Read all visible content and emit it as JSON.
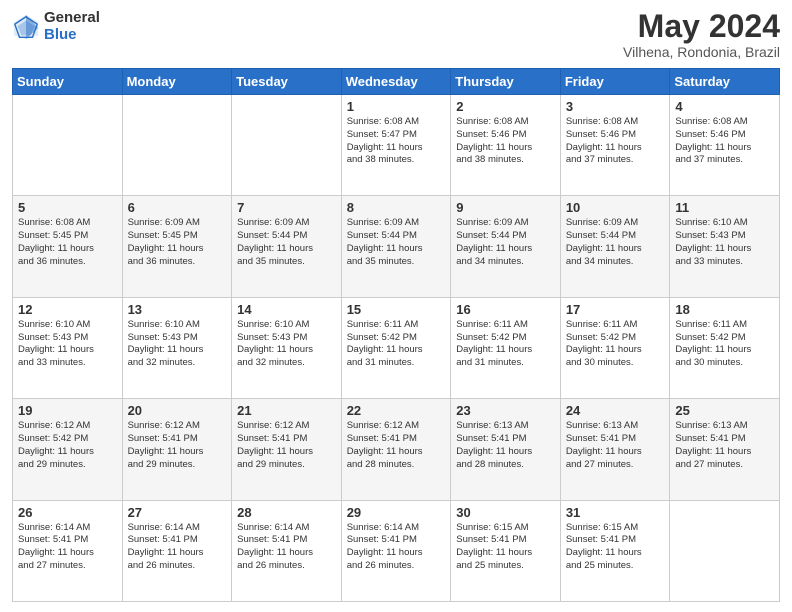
{
  "header": {
    "logo_general": "General",
    "logo_blue": "Blue",
    "month_year": "May 2024",
    "location": "Vilhena, Rondonia, Brazil"
  },
  "columns": [
    "Sunday",
    "Monday",
    "Tuesday",
    "Wednesday",
    "Thursday",
    "Friday",
    "Saturday"
  ],
  "weeks": [
    [
      {
        "day": "",
        "info": ""
      },
      {
        "day": "",
        "info": ""
      },
      {
        "day": "",
        "info": ""
      },
      {
        "day": "1",
        "info": "Sunrise: 6:08 AM\nSunset: 5:47 PM\nDaylight: 11 hours\nand 38 minutes."
      },
      {
        "day": "2",
        "info": "Sunrise: 6:08 AM\nSunset: 5:46 PM\nDaylight: 11 hours\nand 38 minutes."
      },
      {
        "day": "3",
        "info": "Sunrise: 6:08 AM\nSunset: 5:46 PM\nDaylight: 11 hours\nand 37 minutes."
      },
      {
        "day": "4",
        "info": "Sunrise: 6:08 AM\nSunset: 5:46 PM\nDaylight: 11 hours\nand 37 minutes."
      }
    ],
    [
      {
        "day": "5",
        "info": "Sunrise: 6:08 AM\nSunset: 5:45 PM\nDaylight: 11 hours\nand 36 minutes."
      },
      {
        "day": "6",
        "info": "Sunrise: 6:09 AM\nSunset: 5:45 PM\nDaylight: 11 hours\nand 36 minutes."
      },
      {
        "day": "7",
        "info": "Sunrise: 6:09 AM\nSunset: 5:44 PM\nDaylight: 11 hours\nand 35 minutes."
      },
      {
        "day": "8",
        "info": "Sunrise: 6:09 AM\nSunset: 5:44 PM\nDaylight: 11 hours\nand 35 minutes."
      },
      {
        "day": "9",
        "info": "Sunrise: 6:09 AM\nSunset: 5:44 PM\nDaylight: 11 hours\nand 34 minutes."
      },
      {
        "day": "10",
        "info": "Sunrise: 6:09 AM\nSunset: 5:44 PM\nDaylight: 11 hours\nand 34 minutes."
      },
      {
        "day": "11",
        "info": "Sunrise: 6:10 AM\nSunset: 5:43 PM\nDaylight: 11 hours\nand 33 minutes."
      }
    ],
    [
      {
        "day": "12",
        "info": "Sunrise: 6:10 AM\nSunset: 5:43 PM\nDaylight: 11 hours\nand 33 minutes."
      },
      {
        "day": "13",
        "info": "Sunrise: 6:10 AM\nSunset: 5:43 PM\nDaylight: 11 hours\nand 32 minutes."
      },
      {
        "day": "14",
        "info": "Sunrise: 6:10 AM\nSunset: 5:43 PM\nDaylight: 11 hours\nand 32 minutes."
      },
      {
        "day": "15",
        "info": "Sunrise: 6:11 AM\nSunset: 5:42 PM\nDaylight: 11 hours\nand 31 minutes."
      },
      {
        "day": "16",
        "info": "Sunrise: 6:11 AM\nSunset: 5:42 PM\nDaylight: 11 hours\nand 31 minutes."
      },
      {
        "day": "17",
        "info": "Sunrise: 6:11 AM\nSunset: 5:42 PM\nDaylight: 11 hours\nand 30 minutes."
      },
      {
        "day": "18",
        "info": "Sunrise: 6:11 AM\nSunset: 5:42 PM\nDaylight: 11 hours\nand 30 minutes."
      }
    ],
    [
      {
        "day": "19",
        "info": "Sunrise: 6:12 AM\nSunset: 5:42 PM\nDaylight: 11 hours\nand 29 minutes."
      },
      {
        "day": "20",
        "info": "Sunrise: 6:12 AM\nSunset: 5:41 PM\nDaylight: 11 hours\nand 29 minutes."
      },
      {
        "day": "21",
        "info": "Sunrise: 6:12 AM\nSunset: 5:41 PM\nDaylight: 11 hours\nand 29 minutes."
      },
      {
        "day": "22",
        "info": "Sunrise: 6:12 AM\nSunset: 5:41 PM\nDaylight: 11 hours\nand 28 minutes."
      },
      {
        "day": "23",
        "info": "Sunrise: 6:13 AM\nSunset: 5:41 PM\nDaylight: 11 hours\nand 28 minutes."
      },
      {
        "day": "24",
        "info": "Sunrise: 6:13 AM\nSunset: 5:41 PM\nDaylight: 11 hours\nand 27 minutes."
      },
      {
        "day": "25",
        "info": "Sunrise: 6:13 AM\nSunset: 5:41 PM\nDaylight: 11 hours\nand 27 minutes."
      }
    ],
    [
      {
        "day": "26",
        "info": "Sunrise: 6:14 AM\nSunset: 5:41 PM\nDaylight: 11 hours\nand 27 minutes."
      },
      {
        "day": "27",
        "info": "Sunrise: 6:14 AM\nSunset: 5:41 PM\nDaylight: 11 hours\nand 26 minutes."
      },
      {
        "day": "28",
        "info": "Sunrise: 6:14 AM\nSunset: 5:41 PM\nDaylight: 11 hours\nand 26 minutes."
      },
      {
        "day": "29",
        "info": "Sunrise: 6:14 AM\nSunset: 5:41 PM\nDaylight: 11 hours\nand 26 minutes."
      },
      {
        "day": "30",
        "info": "Sunrise: 6:15 AM\nSunset: 5:41 PM\nDaylight: 11 hours\nand 25 minutes."
      },
      {
        "day": "31",
        "info": "Sunrise: 6:15 AM\nSunset: 5:41 PM\nDaylight: 11 hours\nand 25 minutes."
      },
      {
        "day": "",
        "info": ""
      }
    ]
  ]
}
